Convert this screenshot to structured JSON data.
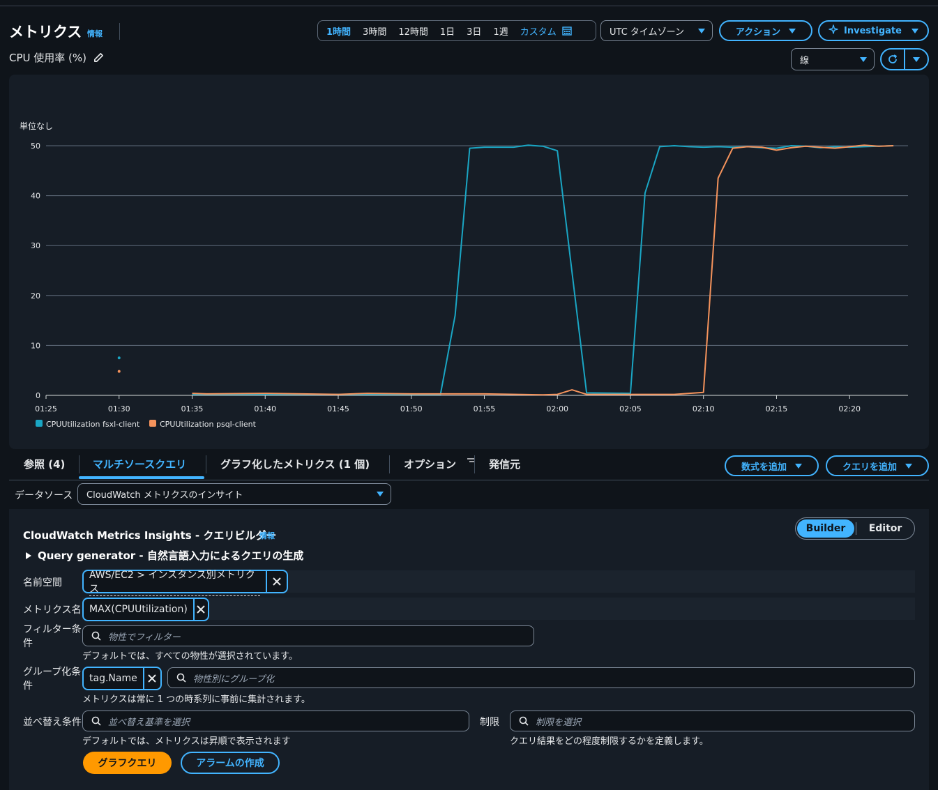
{
  "header": {
    "title": "メトリクス",
    "info": "情報",
    "subtitle": "CPU 使用率 (%)"
  },
  "time_range": {
    "options": [
      "1時間",
      "3時間",
      "12時間",
      "1日",
      "3日",
      "1週"
    ],
    "selected": "1時間",
    "custom": "カスタム"
  },
  "timezone": "UTC タイムゾーン",
  "actions_label": "アクション",
  "investigate_label": "Investigate",
  "graph_type": "線",
  "tabs": {
    "browse": "参照 (4)",
    "multi_source": "マルチソースクエリ",
    "graphed": "グラフ化したメトリクス (1 個)",
    "options": "オプション",
    "source": "発信元"
  },
  "add_math_label": "数式を追加",
  "add_query_label": "クエリを追加",
  "data_source": {
    "label": "データソース",
    "value": "CloudWatch メトリクスのインサイト"
  },
  "query_builder": {
    "title": "CloudWatch Metrics Insights - クエリビルダー",
    "info": "情報",
    "query_generator": "Query generator - 自然言語入力によるクエリの生成",
    "mode_builder": "Builder",
    "mode_editor": "Editor",
    "namespace_label": "名前空間",
    "namespace_value": "AWS/EC2 > インスタンス別メトリクス",
    "metric_label": "メトリクス名",
    "metric_value": "MAX(CPUUtilization)",
    "filter_label_1": "フィルター条",
    "filter_label_2": "件",
    "filter_placeholder": "物性でフィルター",
    "filter_hint": "デフォルトでは、すべての物性が選択されています。",
    "group_label_1": "グループ化条",
    "group_label_2": "件",
    "group_token": "tag.Name",
    "group_placeholder": "物性別にグループ化",
    "group_hint": "メトリクスは常に 1 つの時系列に事前に集計されます。",
    "order_label": "並べ替え条件",
    "order_placeholder": "並べ替え基準を選択",
    "order_hint": "デフォルトでは、メトリクスは昇順で表示されます",
    "limit_label": "制限",
    "limit_placeholder": "制限を選択",
    "limit_hint": "クエリ結果をどの程度制限するかを定義します。",
    "graph_query_button": "グラフクエリ",
    "create_alarm_button": "アラームの作成"
  },
  "colors": {
    "accent": "#42b4ff",
    "series1": "#1aa6c4",
    "series2": "#f5935c",
    "primary_button": "#ff9900"
  },
  "chart_data": {
    "type": "line",
    "ylabel": "単位なし",
    "ylim": [
      0,
      50
    ],
    "yticks": [
      0,
      10,
      20,
      30,
      40,
      50
    ],
    "xticks": [
      "01:25",
      "01:30",
      "01:35",
      "01:40",
      "01:45",
      "01:50",
      "01:55",
      "02:00",
      "02:05",
      "02:10",
      "02:15",
      "02:20"
    ],
    "xrange_minutes": [
      "01:25",
      "02:24"
    ],
    "grid": true,
    "legend_position": "bottom-left",
    "series": [
      {
        "name": "CPUUtilization fsxl-client",
        "color": "#1aa6c4",
        "isolated_points": [
          [
            "01:30",
            7.5
          ]
        ],
        "points": [
          [
            "01:35",
            0.2
          ],
          [
            "01:52",
            0.2
          ],
          [
            "01:53",
            16
          ],
          [
            "01:54",
            49.5
          ],
          [
            "01:55",
            49.7
          ],
          [
            "01:57",
            49.7
          ],
          [
            "01:58",
            50.1
          ],
          [
            "01:59",
            49.9
          ],
          [
            "02:00",
            49
          ],
          [
            "02:02",
            0.5
          ],
          [
            "02:05",
            0.4
          ],
          [
            "02:06",
            40.5
          ],
          [
            "02:07",
            49.8
          ],
          [
            "02:08",
            50
          ],
          [
            "02:09",
            49.8
          ],
          [
            "02:10",
            49.7
          ],
          [
            "02:11",
            49.8
          ],
          [
            "02:12",
            49.7
          ],
          [
            "02:13",
            49.8
          ],
          [
            "02:14",
            49.6
          ],
          [
            "02:15",
            49.5
          ],
          [
            "02:16",
            50
          ],
          [
            "02:17",
            49.9
          ],
          [
            "02:18",
            49.6
          ],
          [
            "02:19",
            49.8
          ],
          [
            "02:20",
            49.7
          ],
          [
            "02:21",
            49.8
          ],
          [
            "02:22",
            49.9
          ],
          [
            "02:23",
            50
          ]
        ]
      },
      {
        "name": "CPUUtilization psql-client",
        "color": "#f5935c",
        "isolated_points": [
          [
            "01:30",
            4.8
          ]
        ],
        "points": [
          [
            "01:35",
            0.4
          ],
          [
            "01:36",
            0.3
          ],
          [
            "01:40",
            0.4
          ],
          [
            "01:45",
            0.2
          ],
          [
            "01:47",
            0.4
          ],
          [
            "01:50",
            0.3
          ],
          [
            "01:55",
            0.3
          ],
          [
            "01:59",
            0.1
          ],
          [
            "02:00",
            0.2
          ],
          [
            "02:01",
            1.1
          ],
          [
            "02:02",
            0.2
          ],
          [
            "02:05",
            0.2
          ],
          [
            "02:08",
            0.2
          ],
          [
            "02:10",
            0.6
          ],
          [
            "02:11",
            43.5
          ],
          [
            "02:12",
            49.5
          ],
          [
            "02:13",
            49.8
          ],
          [
            "02:14",
            49.7
          ],
          [
            "02:15",
            49.1
          ],
          [
            "02:16",
            49.6
          ],
          [
            "02:17",
            49.9
          ],
          [
            "02:18",
            49.7
          ],
          [
            "02:19",
            49.5
          ],
          [
            "02:20",
            49.8
          ],
          [
            "02:21",
            50.1
          ],
          [
            "02:22",
            49.9
          ],
          [
            "02:23",
            50
          ]
        ]
      }
    ]
  }
}
